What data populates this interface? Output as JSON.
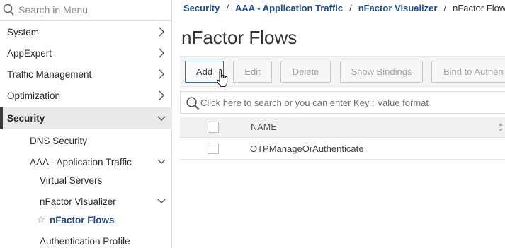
{
  "sidebar": {
    "search_placeholder": "Search in Menu",
    "items": [
      {
        "label": "System"
      },
      {
        "label": "AppExpert"
      },
      {
        "label": "Traffic Management"
      },
      {
        "label": "Optimization"
      },
      {
        "label": "Security"
      },
      {
        "label": "DNS Security"
      },
      {
        "label": "AAA - Application Traffic"
      },
      {
        "label": "Virtual Servers"
      },
      {
        "label": "nFactor Visualizer"
      },
      {
        "label": "nFactor Flows"
      },
      {
        "label": "Authentication Profile"
      }
    ]
  },
  "breadcrumb": {
    "items": [
      "Security",
      "AAA - Application Traffic",
      "nFactor Visualizer"
    ],
    "current": "nFactor Flows",
    "separator": "/"
  },
  "page": {
    "title": "nFactor Flows"
  },
  "toolbar": {
    "add": "Add",
    "edit": "Edit",
    "delete": "Delete",
    "show_bindings": "Show Bindings",
    "bind_to_auth": "Bind to Authen"
  },
  "search": {
    "placeholder": "Click here to search or you can enter Key : Value format"
  },
  "table": {
    "columns": [
      "NAME"
    ],
    "rows": [
      {
        "name": "OTPManageOrAuthenticate"
      }
    ]
  },
  "colors": {
    "link": "#1a5296",
    "accent_border": "#3b6ea8",
    "active_bg": "#e9e9e9"
  }
}
